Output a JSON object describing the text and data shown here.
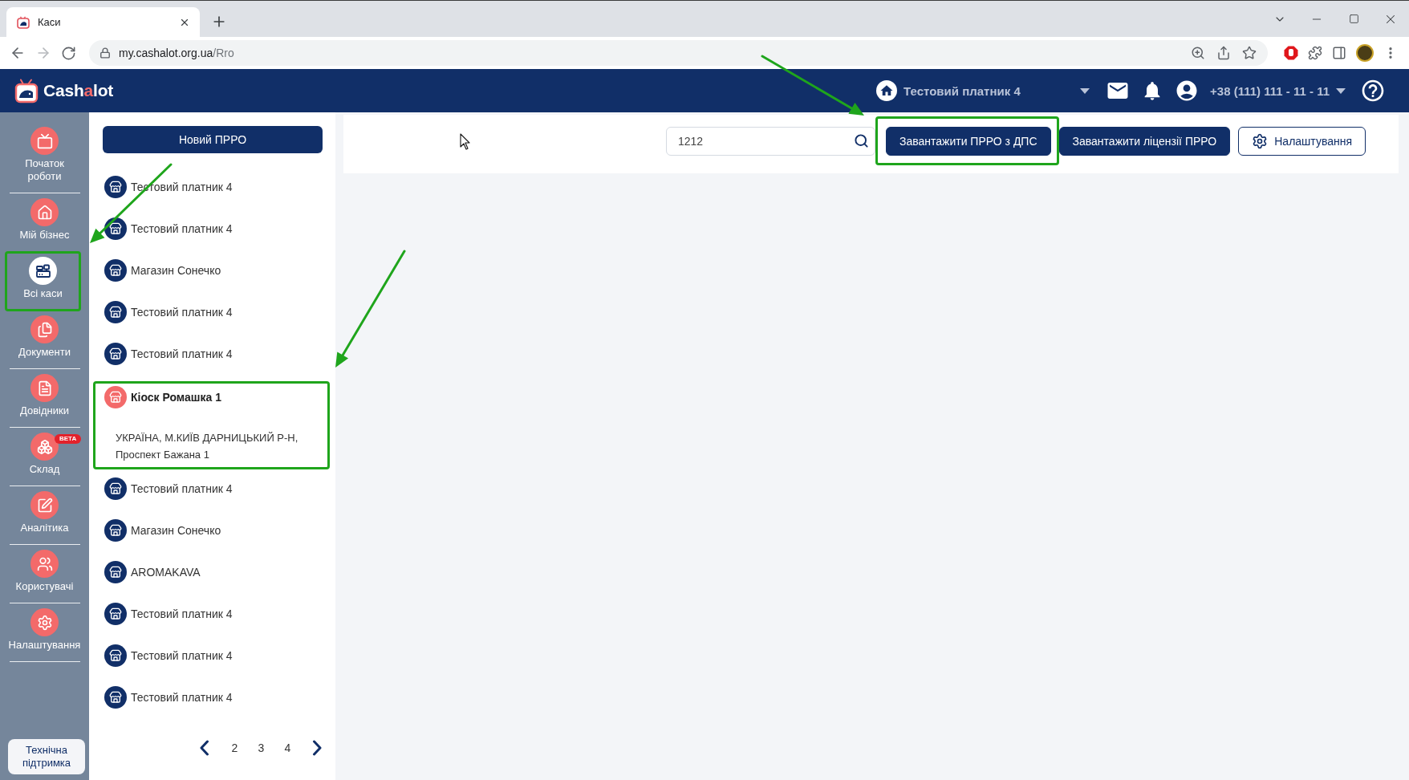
{
  "browser": {
    "tabs": [
      {
        "title": "Каси",
        "selected": true
      }
    ],
    "url": {
      "host": "my.cashalot.org.ua",
      "path": "/Rro"
    }
  },
  "header": {
    "logo": [
      {
        "text": "Cash",
        "accent": false
      },
      {
        "text": "a",
        "accent": true
      },
      {
        "text": "lot",
        "accent": false
      }
    ],
    "company": "Тестовий платник 4",
    "phone": "+38 (111) 111 - 11 - 11"
  },
  "sidebar": {
    "items": [
      {
        "label": "Початок роботи",
        "selected": false,
        "highlighted": false
      },
      {
        "label": "Мій бізнес",
        "selected": false,
        "highlighted": false
      },
      {
        "label": "Всі каси",
        "selected": true,
        "highlighted": true
      },
      {
        "label": "Документи",
        "selected": false,
        "highlighted": false
      },
      {
        "label": "Довідники",
        "selected": false,
        "highlighted": false
      },
      {
        "label": "Склад",
        "badge": "BETA",
        "selected": false,
        "highlighted": false
      },
      {
        "label": "Аналітика",
        "selected": false,
        "highlighted": false
      },
      {
        "label": "Користувачі",
        "selected": false,
        "highlighted": false
      },
      {
        "label": "Налаштування",
        "selected": false,
        "highlighted": false
      }
    ],
    "support_button": "Технічна підтримка"
  },
  "registers": {
    "new_button": "Новий ПРРО",
    "items": [
      {
        "name": "Тестовий платник 4",
        "selected": false,
        "highlighted": false
      },
      {
        "name": "Тестовий платник 4",
        "selected": false,
        "highlighted": false
      },
      {
        "name": "Магазин Сонечко",
        "selected": false,
        "highlighted": false
      },
      {
        "name": "Тестовий платник 4",
        "selected": false,
        "highlighted": false
      },
      {
        "name": "Тестовий платник 4",
        "selected": false,
        "highlighted": false
      },
      {
        "name": "Кіоск Ромашка 1",
        "address": "УКРАЇНА, М.КИЇВ ДАРНИЦЬКИЙ Р-Н, Проспект Бажана 1",
        "selected": true,
        "highlighted": true
      },
      {
        "name": "Тестовий платник 4",
        "selected": false,
        "highlighted": false
      },
      {
        "name": "Магазин Сонечко",
        "selected": false,
        "highlighted": false
      },
      {
        "name": "AROMAKAVA",
        "selected": false,
        "highlighted": false
      },
      {
        "name": "Тестовий платник 4",
        "selected": false,
        "highlighted": false
      },
      {
        "name": "Тестовий платник 4",
        "selected": false,
        "highlighted": false
      },
      {
        "name": "Тестовий платник 4",
        "selected": false,
        "highlighted": false
      }
    ],
    "pagination": {
      "pages": [
        "2",
        "3",
        "4"
      ]
    }
  },
  "toolbar": {
    "search": {
      "value": "1212"
    },
    "buttons": [
      {
        "label": "Завантажити ПРРО з ДПС",
        "kind": "primary",
        "highlighted": true
      },
      {
        "label": "Завантажити ліцензії ПРРО",
        "kind": "primary",
        "highlighted": false
      },
      {
        "label": "Налаштування",
        "kind": "secondary",
        "highlighted": false
      }
    ]
  }
}
